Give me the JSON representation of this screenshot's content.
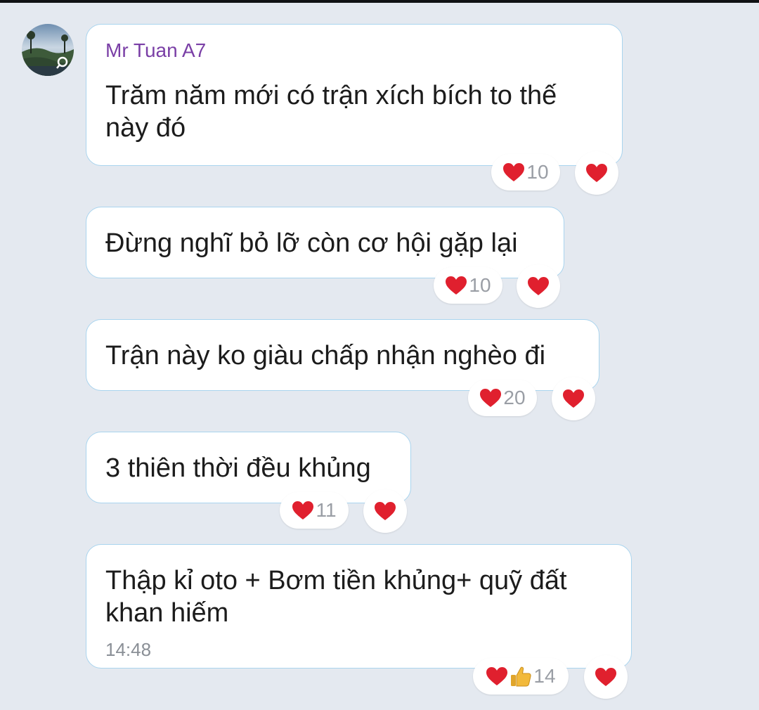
{
  "chat": {
    "sender_name": "Mr Tuan A7",
    "messages": [
      {
        "text": "Trăm năm mới có trận xích bích to thế\nnày đó",
        "reaction_count": "10",
        "reaction_icons": [
          "heart-icon"
        ]
      },
      {
        "text": "Đừng nghĩ bỏ lỡ còn cơ hội gặp lại",
        "reaction_count": "10",
        "reaction_icons": [
          "heart-icon"
        ]
      },
      {
        "text": "Trận này ko giàu chấp nhận nghèo đi",
        "reaction_count": "20",
        "reaction_icons": [
          "heart-icon"
        ]
      },
      {
        "text": "3 thiên thời đều khủng",
        "reaction_count": "11",
        "reaction_icons": [
          "heart-icon"
        ]
      },
      {
        "text": "Thập kỉ oto + Bơm tiền khủng+ quỹ đất\nkhan hiếm",
        "timestamp": "14:48",
        "reaction_count": "14",
        "reaction_icons": [
          "heart-icon",
          "thumbs-up-icon"
        ]
      }
    ]
  },
  "colors": {
    "background": "#e4e9f0",
    "bubble_border": "#a9d4ee",
    "sender_name": "#7a3fa6",
    "heart": "#e0202e",
    "thumbs_up": "#f2b93b"
  }
}
